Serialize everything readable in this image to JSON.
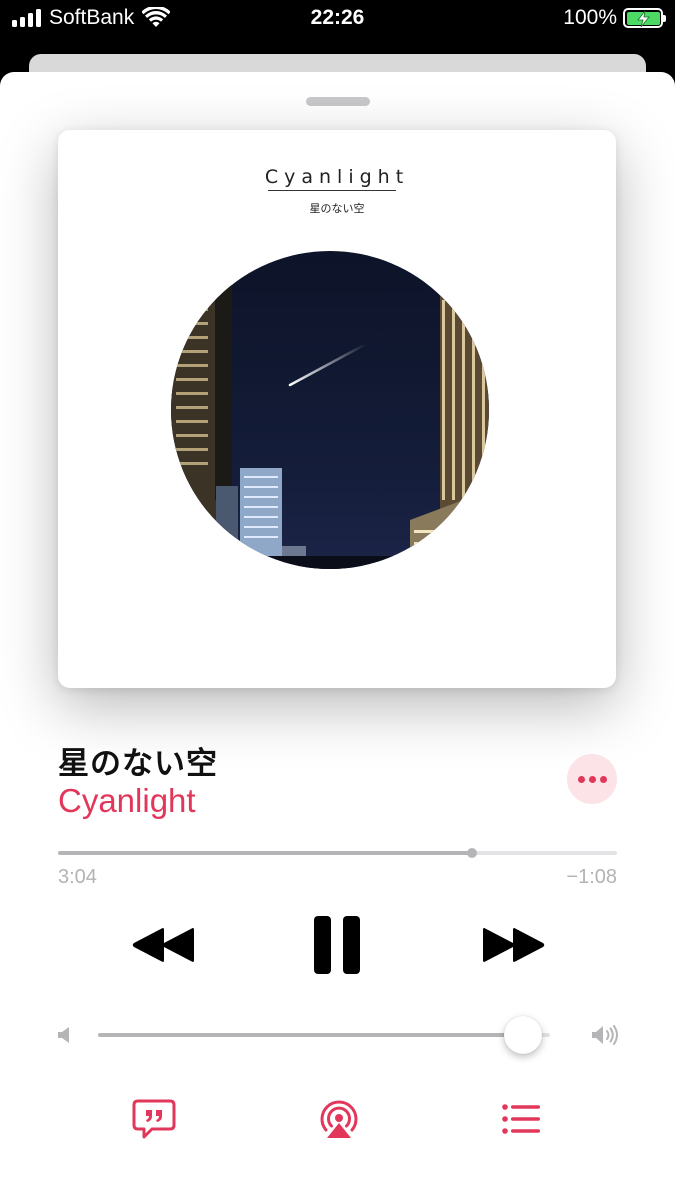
{
  "status_bar": {
    "carrier": "SoftBank",
    "time": "22:26",
    "battery_percent": "100%",
    "battery_charging": true
  },
  "artwork": {
    "title_text": "Cyanlight",
    "subtitle_text": "星のない空"
  },
  "now_playing": {
    "title": "星のない空",
    "artist": "Cyanlight",
    "elapsed": "3:04",
    "remaining": "−1:08",
    "progress_fraction": 0.74,
    "volume_fraction": 0.94
  },
  "colors": {
    "accent": "#e2375a",
    "more_bg": "#fbe3e8",
    "track_bg": "#e3e3e6",
    "track_fill": "#b5b5b8"
  },
  "icons": {
    "more": "ellipsis-icon",
    "rewind": "rewind-icon",
    "pause": "pause-icon",
    "fast_forward": "fast-forward-icon",
    "volume_low": "speaker-low-icon",
    "volume_high": "speaker-high-icon",
    "lyrics": "lyrics-icon",
    "airplay": "airplay-icon",
    "queue": "queue-list-icon"
  }
}
